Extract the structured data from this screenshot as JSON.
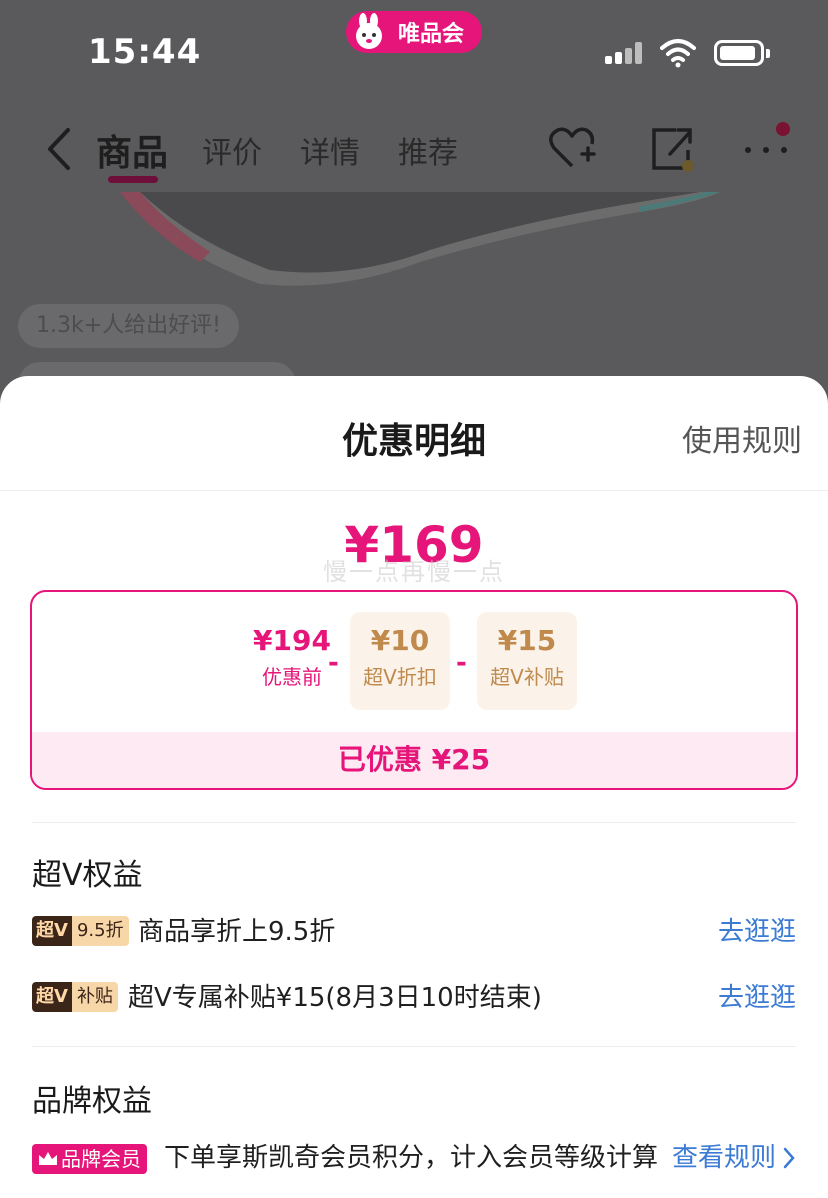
{
  "status_bar": {
    "time": "15:44",
    "app_name": "唯品会"
  },
  "nav": {
    "tabs": [
      {
        "label": "商品",
        "active": true
      },
      {
        "label": "评价",
        "active": false
      },
      {
        "label": "详情",
        "active": false
      },
      {
        "label": "推荐",
        "active": false
      }
    ]
  },
  "background": {
    "review_bubble": "1.3k+人给出好评!"
  },
  "sheet": {
    "title": "优惠明细",
    "rules_link": "使用规则",
    "final_price": "¥169",
    "watermark": "慢一点再慢一点",
    "breakdown": {
      "original": {
        "amount": "¥194",
        "label": "优惠前"
      },
      "discounts": [
        {
          "amount": "¥10",
          "label": "超V折扣"
        },
        {
          "amount": "¥15",
          "label": "超V补贴"
        }
      ],
      "minus_sign": "-",
      "saved": "已优惠 ¥25"
    },
    "super_v": {
      "title": "超V权益",
      "items": [
        {
          "tag_dark": "超V",
          "tag_light": "9.5折",
          "text": "商品享折上9.5折",
          "link": "去逛逛"
        },
        {
          "tag_dark": "超V",
          "tag_light": "补贴",
          "text": "超V专属补贴¥15(8月3日10时结束)",
          "link": "去逛逛"
        }
      ]
    },
    "brand": {
      "title": "品牌权益",
      "tag": "品牌会员",
      "text": "下单享斯凯奇会员积分，计入会员等级计算",
      "link": "查看规则"
    }
  },
  "colors": {
    "accent": "#e6157a",
    "link": "#3b7bd4",
    "discount_gold": "#c08a4c"
  }
}
